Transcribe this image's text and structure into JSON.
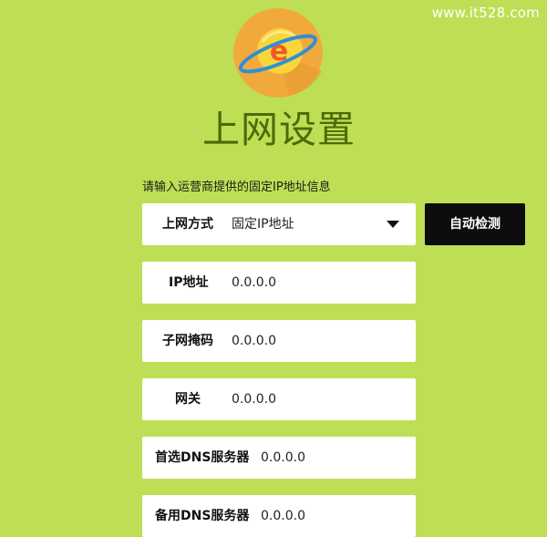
{
  "watermark": "www.it528.com",
  "logo": {
    "icon": "browser-e-planet-icon",
    "colors": {
      "circle": "#f2a93b",
      "planet": "#f7d63a",
      "letter": "#f05a28",
      "ring": "#2d8fd8"
    }
  },
  "title": "上网设置",
  "hint": "请输入运营商提供的固定IP地址信息",
  "connection_type": {
    "label": "上网方式",
    "value": "固定IP地址"
  },
  "detect_button": "自动检测",
  "fields": [
    {
      "label": "IP地址",
      "value": "0.0.0.0"
    },
    {
      "label": "子网掩码",
      "value": "0.0.0.0"
    },
    {
      "label": "网关",
      "value": "0.0.0.0"
    },
    {
      "label": "首选DNS服务器",
      "value": "0.0.0.0"
    },
    {
      "label": "备用DNS服务器",
      "value": "0.0.0.0"
    }
  ],
  "colors": {
    "background": "#bedf55",
    "title": "#4a6b08",
    "button": "#0d0d0d"
  }
}
